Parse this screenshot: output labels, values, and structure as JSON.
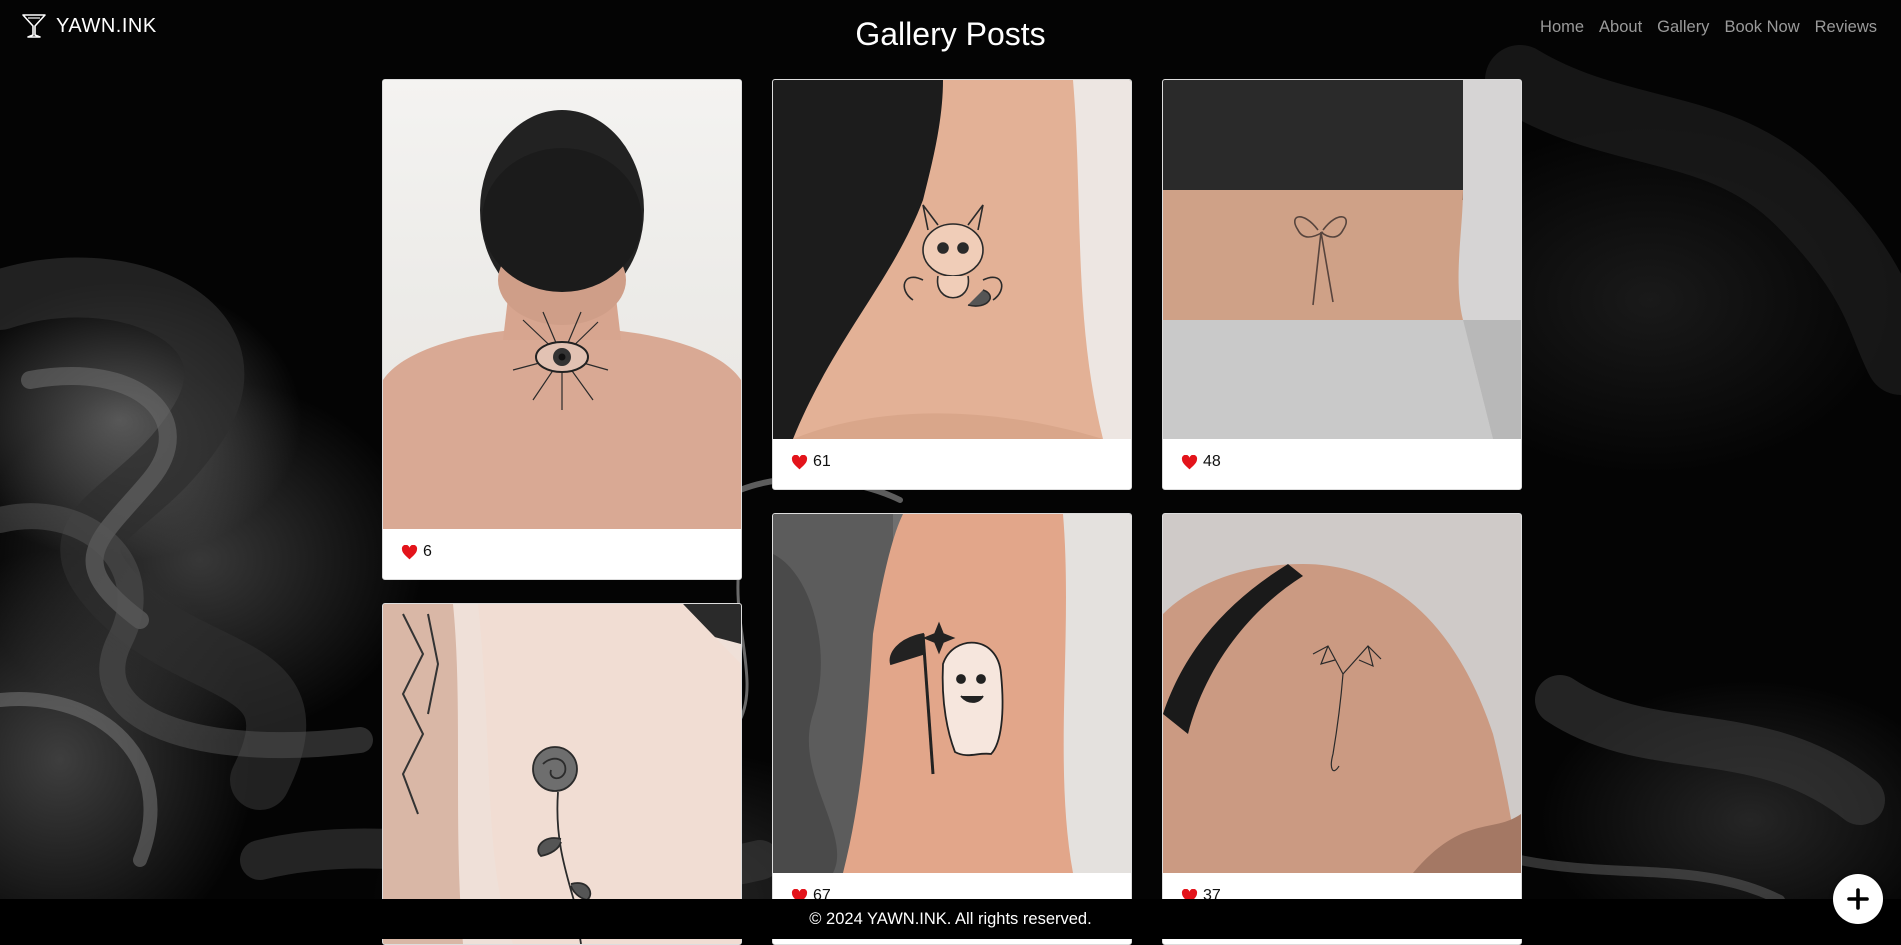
{
  "brand": {
    "name": "YAWN.INK",
    "logo_icon": "martini-glass-icon"
  },
  "page_title": "Gallery Posts",
  "nav": {
    "items": [
      {
        "label": "Home"
      },
      {
        "label": "About"
      },
      {
        "label": "Gallery"
      },
      {
        "label": "Book Now"
      },
      {
        "label": "Reviews"
      }
    ]
  },
  "gallery": {
    "posts": [
      {
        "subject": "eye tattoo on back of neck",
        "likes": "6"
      },
      {
        "subject": "small dragon tattoo on upper arm",
        "likes": "61"
      },
      {
        "subject": "bow tattoo on lower back",
        "likes": "48"
      },
      {
        "subject": "rose tattoo on side",
        "likes": ""
      },
      {
        "subject": "ghost with scythe tattoo on arm",
        "likes": "67"
      },
      {
        "subject": "dragon tattoo on shoulder",
        "likes": "37"
      }
    ]
  },
  "footer": {
    "copyright": "© 2024 YAWN.INK. All rights reserved."
  },
  "fab": {
    "icon": "plus-icon"
  },
  "colors": {
    "background": "#000000",
    "heart": "#e3141b",
    "card": "#ffffff",
    "nav_link": "#9a9a9a"
  }
}
